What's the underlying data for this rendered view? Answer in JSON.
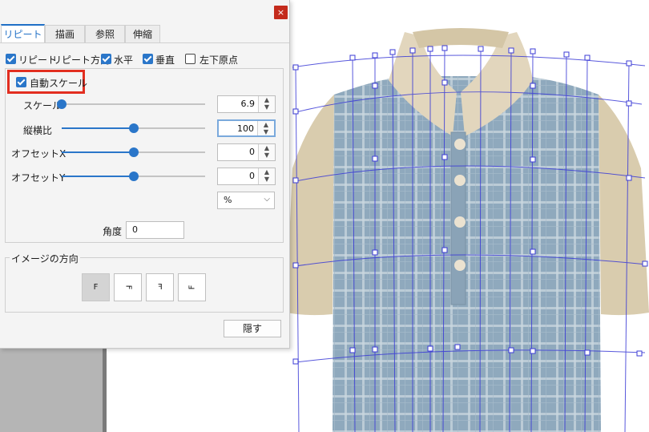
{
  "dialog": {
    "close_glyph": "×",
    "tabs": [
      {
        "label": "リピート",
        "active": true
      },
      {
        "label": "描画",
        "active": false
      },
      {
        "label": "参照",
        "active": false
      },
      {
        "label": "伸縮",
        "active": false
      }
    ],
    "top_options": [
      {
        "label": "リピート",
        "checked": true
      },
      {
        "label": "リピート方向",
        "checked": null
      },
      {
        "label": "水平",
        "checked": true
      },
      {
        "label": "垂直",
        "checked": true
      },
      {
        "label": "左下原点",
        "checked": false
      }
    ],
    "auto_scale": {
      "label": "自動スケール",
      "checked": true
    },
    "sliders": [
      {
        "label": "スケール",
        "value": "6.9",
        "level": 0.0
      },
      {
        "label": "縦横比",
        "value": "100",
        "level": 0.5,
        "focused": true
      },
      {
        "label": "オフセットX",
        "value": "0",
        "level": 0.5
      },
      {
        "label": "オフセットY",
        "value": "0",
        "level": 0.5
      }
    ],
    "unit_select": "%",
    "angle": {
      "label": "角度",
      "value": "0"
    },
    "orientation": {
      "title": "イメージの方向",
      "buttons": [
        {
          "glyph": "F",
          "selected": true
        },
        {
          "glyph": "F",
          "selected": false
        },
        {
          "glyph": "F",
          "selected": false
        },
        {
          "glyph": "F",
          "selected": false
        }
      ]
    },
    "hide_button": "隠す"
  },
  "colors": {
    "accent": "#2a76c9",
    "highlight": "#e22e20",
    "close": "#c42b1c",
    "shirt_body": "#8fa9bd",
    "collar": "#e2d6bd",
    "mesh": "#3b3bd6"
  },
  "canvas": {
    "subject": "plaid polo shirt with mesh overlay"
  }
}
